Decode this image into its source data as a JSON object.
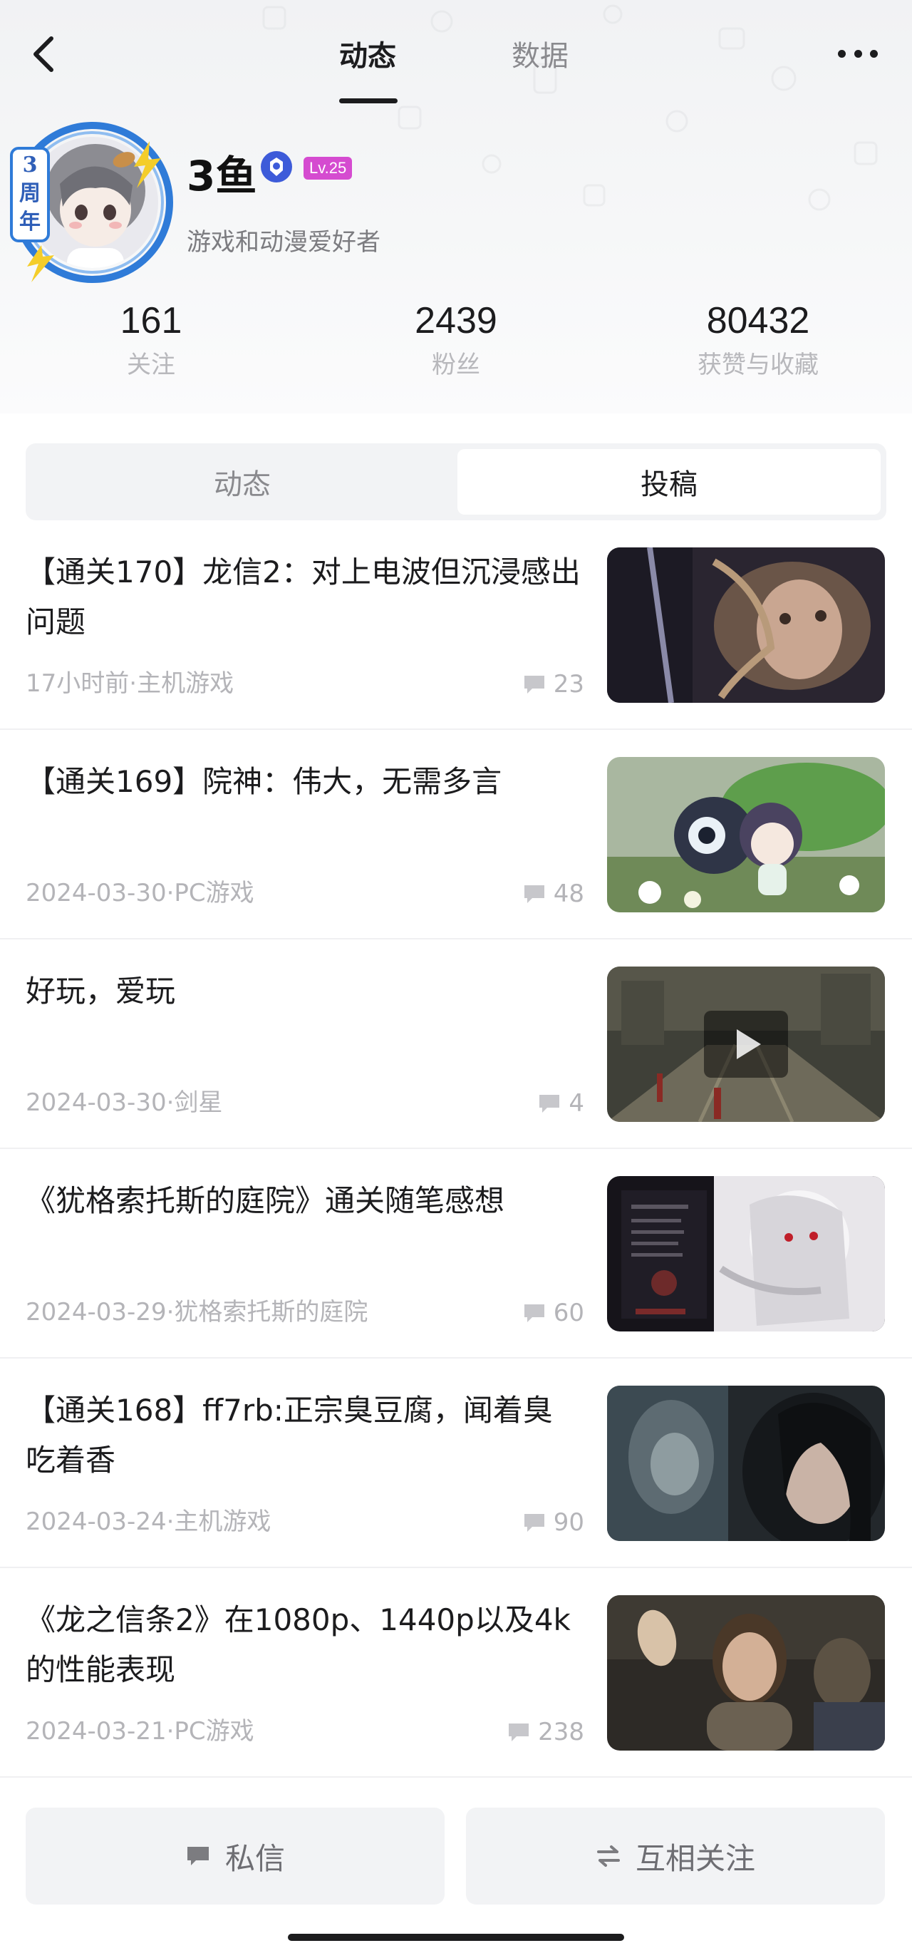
{
  "nav": {
    "tabs": [
      {
        "label": "动态",
        "active": true
      },
      {
        "label": "数据",
        "active": false
      }
    ]
  },
  "profile": {
    "avatar_caption": "3周年",
    "name": "3鱼",
    "level": "Lv.25",
    "bio": "游戏和动漫爱好者"
  },
  "stats": [
    {
      "value": "161",
      "label": "关注"
    },
    {
      "value": "2439",
      "label": "粉丝"
    },
    {
      "value": "80432",
      "label": "获赞与收藏"
    }
  ],
  "segment": {
    "items": [
      {
        "label": "动态",
        "active": false
      },
      {
        "label": "投稿",
        "active": true
      }
    ]
  },
  "posts": [
    {
      "title": "【通关170】龙信2：对上电波但沉浸感出问题",
      "meta": "17小时前·主机游戏",
      "comments": "23",
      "thumb": "dark-armored-character"
    },
    {
      "title": "【通关169】院神：伟大，无需多言",
      "meta": "2024-03-30·PC游戏",
      "comments": "48",
      "thumb": "anime-girl-with-cat-and-leaf"
    },
    {
      "title": "好玩，爱玩",
      "meta": "2024-03-30·剑星",
      "comments": "4",
      "thumb": "video-game-street-scene",
      "has_video": true
    },
    {
      "title": "《犹格索托斯的庭院》通关随笔感想",
      "meta": "2024-03-29·犹格索托斯的庭院",
      "comments": "60",
      "thumb": "dark-menu-with-white-haired-girl"
    },
    {
      "title": "【通关168】ff7rb:正宗臭豆腐，闻着臭吃着香",
      "meta": "2024-03-24·主机游戏",
      "comments": "90",
      "thumb": "ff7-characters-closeup"
    },
    {
      "title": "《龙之信条2》在1080p、1440p以及4k的性能表现",
      "meta": "2024-03-21·PC游戏",
      "comments": "238",
      "thumb": "dragons-dogma-woman-waving"
    }
  ],
  "actions": {
    "message": "私信",
    "follow": "互相关注"
  },
  "colors": {
    "level_badge": "#d54bd0",
    "verify_badge": "#3d5bd9",
    "avatar_ring": "#2f7bd8"
  }
}
